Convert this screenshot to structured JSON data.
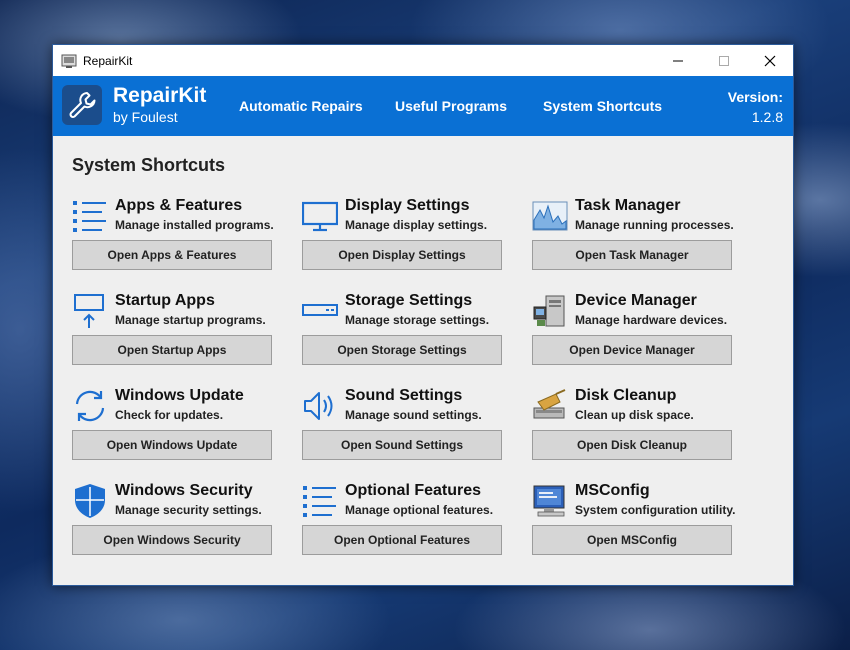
{
  "window": {
    "title": "RepairKit",
    "controls": [
      "minimize-icon",
      "maximize-icon",
      "close-icon"
    ]
  },
  "header": {
    "app_name": "RepairKit",
    "byline": "by Foulest",
    "nav": [
      "Automatic Repairs",
      "Useful Programs",
      "System Shortcuts"
    ],
    "version_label": "Version:",
    "version_number": "1.2.8",
    "accent_color": "#0a70d4"
  },
  "main": {
    "section_title": "System Shortcuts",
    "cards": [
      {
        "title": "Apps & Features",
        "desc": "Manage installed programs.",
        "button": "Open Apps & Features",
        "icon": "list-icon"
      },
      {
        "title": "Display Settings",
        "desc": "Manage display settings.",
        "button": "Open Display Settings",
        "icon": "monitor-icon"
      },
      {
        "title": "Task Manager",
        "desc": "Manage running processes.",
        "button": "Open Task Manager",
        "icon": "performance-graph-icon"
      },
      {
        "title": "Startup Apps",
        "desc": "Manage startup programs.",
        "button": "Open Startup Apps",
        "icon": "startup-icon"
      },
      {
        "title": "Storage Settings",
        "desc": "Manage storage settings.",
        "button": "Open Storage Settings",
        "icon": "drive-icon"
      },
      {
        "title": "Device Manager",
        "desc": "Manage hardware devices.",
        "button": "Open Device Manager",
        "icon": "device-manager-icon"
      },
      {
        "title": "Windows Update",
        "desc": "Check for updates.",
        "button": "Open Windows Update",
        "icon": "refresh-icon"
      },
      {
        "title": "Sound Settings",
        "desc": "Manage sound settings.",
        "button": "Open Sound Settings",
        "icon": "speaker-icon"
      },
      {
        "title": "Disk Cleanup",
        "desc": "Clean up disk space.",
        "button": "Open Disk Cleanup",
        "icon": "disk-cleanup-icon"
      },
      {
        "title": "Windows Security",
        "desc": "Manage security settings.",
        "button": "Open Windows Security",
        "icon": "shield-icon"
      },
      {
        "title": "Optional Features",
        "desc": "Manage optional features.",
        "button": "Open Optional Features",
        "icon": "list-icon"
      },
      {
        "title": "MSConfig",
        "desc": "System configuration utility.",
        "button": "Open MSConfig",
        "icon": "msconfig-icon"
      }
    ]
  }
}
